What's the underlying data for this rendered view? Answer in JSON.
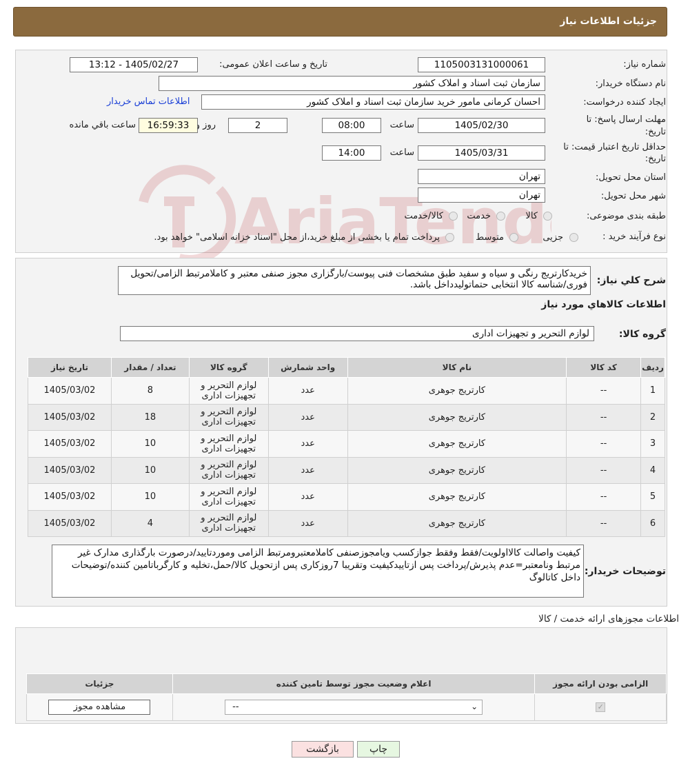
{
  "header": {
    "title": "جزئیات اطلاعات نیاز"
  },
  "watermark_text": "AriaTender.neT",
  "form": {
    "need_number_label": "شماره نیاز:",
    "need_number": "1105003131000061",
    "announce_label": "تاریخ و ساعت اعلان عمومی:",
    "announce_value": "1405/02/27 - 13:12",
    "buyer_org_label": "نام دستگاه خریدار:",
    "buyer_org": "سازمان ثبت اسناد و املاک کشور",
    "requester_label": "ایجاد کننده درخواست:",
    "requester": "احسان کرمانی مامور خرید سازمان ثبت اسناد و املاک کشور",
    "contact_link": "اطلاعات تماس خریدار",
    "deadline_label_1": "مهلت ارسال پاسخ: تا",
    "deadline_label_2": "تاریخ:",
    "deadline_date": "1405/02/30",
    "time_label": "ساعت",
    "deadline_time": "08:00",
    "days_value": "2",
    "days_label": "روز و",
    "remaining_time": "16:59:33",
    "remaining_label": "ساعت باقي مانده",
    "validity_label_1": "حداقل تاریخ اعتبار قیمت: تا",
    "validity_label_2": "تاریخ:",
    "validity_date": "1405/03/31",
    "validity_time": "14:00",
    "province_label": "استان محل تحویل:",
    "province": "تهران",
    "city_label": "شهر محل تحویل:",
    "city": "تهران",
    "category_label": "طبقه بندی موضوعی:",
    "category_options": [
      "کالا",
      "خدمت",
      "کالا/خدمت"
    ],
    "process_label": "نوع فرآیند خرید :",
    "process_options": [
      "جزیی",
      "متوسط"
    ],
    "process_note": "پرداخت تمام یا بخشی از مبلغ خرید،از محل \"اسناد خزانه اسلامی\" خواهد بود."
  },
  "description": {
    "label": "شرح کلي نياز:",
    "text": "خریدکارتریج رنگی و سیاه و سفید طبق مشخصات فنی پیوست/بارگزاری مجوز صنفی معتبر و کاملامرتبط الزامی/تحویل فوری/شناسه کالا انتخابی حتماتولیدداخل باشد."
  },
  "goods": {
    "section_title": "اطلاعات کالاهاي مورد نياز",
    "group_label": "گروه کالا:",
    "group_value": "لوازم التحریر و تجهیزات اداری",
    "columns": [
      "ردیف",
      "کد کالا",
      "نام کالا",
      "واحد شمارش",
      "گروه کالا",
      "تعداد / مقدار",
      "تاریخ نیاز"
    ],
    "rows": [
      {
        "idx": "1",
        "code": "--",
        "name": "کارتریج جوهری",
        "unit": "عدد",
        "group": "لوازم التحریر و تجهیزات اداری",
        "qty": "8",
        "date": "1405/03/02"
      },
      {
        "idx": "2",
        "code": "--",
        "name": "کارتریج جوهری",
        "unit": "عدد",
        "group": "لوازم التحریر و تجهیزات اداری",
        "qty": "18",
        "date": "1405/03/02"
      },
      {
        "idx": "3",
        "code": "--",
        "name": "کارتریج جوهری",
        "unit": "عدد",
        "group": "لوازم التحریر و تجهیزات اداری",
        "qty": "10",
        "date": "1405/03/02"
      },
      {
        "idx": "4",
        "code": "--",
        "name": "کارتریج جوهری",
        "unit": "عدد",
        "group": "لوازم التحریر و تجهیزات اداری",
        "qty": "10",
        "date": "1405/03/02"
      },
      {
        "idx": "5",
        "code": "--",
        "name": "کارتریج جوهری",
        "unit": "عدد",
        "group": "لوازم التحریر و تجهیزات اداری",
        "qty": "10",
        "date": "1405/03/02"
      },
      {
        "idx": "6",
        "code": "--",
        "name": "کارتریج جوهری",
        "unit": "عدد",
        "group": "لوازم التحریر و تجهیزات اداری",
        "qty": "4",
        "date": "1405/03/02"
      }
    ]
  },
  "buyer_notes": {
    "label": "توضیحات خریدار:",
    "text": "کیفیت واصالت کالااولویت/فقط وفقط جوازکسب ویامجوزصنفی کاملامعتبرومرتبط الزامی وموردتایید/درصورت بارگذاری مدارک غیر مرتبط ونامعتبر=عدم پذیرش/پرداخت پس ازتاییدکیفیت وتقریبا 7روزکاری پس ازتحویل کالا/حمل،تخلیه و کارگرباتامین کننده/توضیحات داخل کاتالوگ"
  },
  "permits": {
    "section_title": "اطلاعات مجوزهای ارائه خدمت / کالا",
    "columns": [
      "الزامی بودن ارائه مجوز",
      "اعلام وضعیت مجوز توسط تامین کننده",
      "جزئیات"
    ],
    "select_value": "--",
    "view_button": "مشاهده مجوز"
  },
  "buttons": {
    "print": "چاپ",
    "back": "بازگشت"
  }
}
